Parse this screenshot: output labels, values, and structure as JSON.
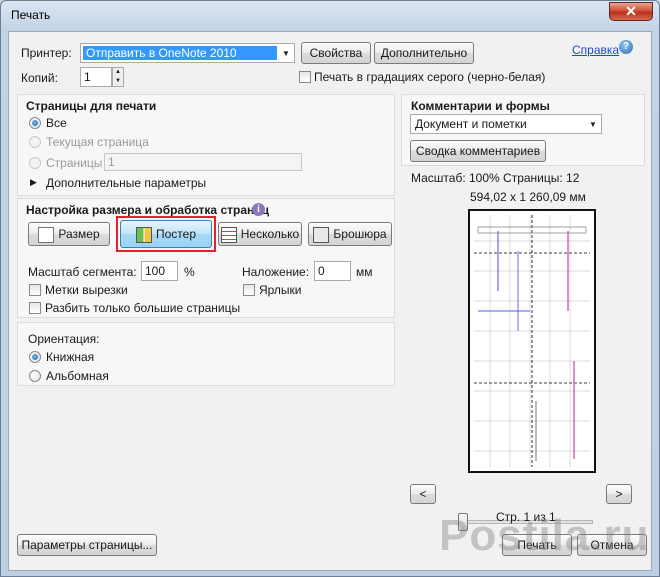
{
  "window": {
    "title": "Печать",
    "close_glyph": "✕"
  },
  "printer": {
    "label": "Принтер:",
    "value": "Отправить в OneNote 2010",
    "properties_btn": "Свойства",
    "advanced_btn": "Дополнительно",
    "help_link": "Справка",
    "help_glyph": "?"
  },
  "copies": {
    "label": "Копий:",
    "value": "1",
    "grayscale_label": "Печать в градациях серого (черно-белая)"
  },
  "pages": {
    "heading": "Страницы для печати",
    "all": "Все",
    "current": "Текущая страница",
    "range": "Страницы",
    "range_value": "1",
    "more_options": "Дополнительные параметры"
  },
  "sizing": {
    "heading": "Настройка размера и обработка страниц",
    "info_glyph": "i",
    "size_btn": "Размер",
    "poster_btn": "Постер",
    "multiple_btn": "Несколько",
    "booklet_btn": "Брошюра",
    "tile_scale_label": "Масштаб сегмента:",
    "tile_scale_value": "100",
    "percent": "%",
    "overlap_label": "Наложение:",
    "overlap_value": "0",
    "mm": "мм",
    "cut_marks": "Метки вырезки",
    "labels": "Ярлыки",
    "tile_large_only": "Разбить только большие страницы"
  },
  "orientation": {
    "heading": "Ориентация:",
    "portrait": "Книжная",
    "landscape": "Альбомная"
  },
  "comments": {
    "heading": "Комментарии и формы",
    "value": "Документ и пометки",
    "summary_btn": "Сводка комментариев"
  },
  "preview": {
    "scale_text": "Масштаб: 100% Страницы: 12",
    "dimensions": "594,02 x 1 260,09 мм",
    "prev_glyph": "<",
    "next_glyph": ">",
    "page_text": "Стр. 1 из 1"
  },
  "footer": {
    "page_setup_btn": "Параметры страницы...",
    "print_btn": "Печать",
    "cancel_btn": "Отмена"
  },
  "watermark": {
    "text": "Postila.ru"
  },
  "colors": {
    "poster_highlight": "#e0242b",
    "selected_field": "#3399ff"
  }
}
